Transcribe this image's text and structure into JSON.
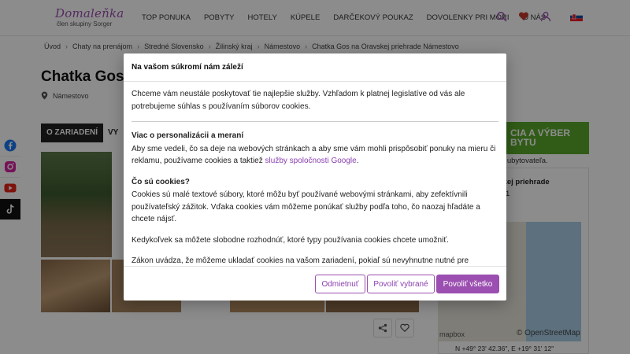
{
  "header": {
    "brand": "Domaleňka",
    "brand_sub": "člen skupiny Sorger",
    "nav": [
      "TOP PONUKA",
      "POBYTY",
      "HOTELY",
      "KÚPELE",
      "DARČEKOVÝ POUKAZ",
      "DOVOLENKY PRI MORI",
      "O NÁS"
    ],
    "icons": [
      "search-icon",
      "heart-icon",
      "user-icon"
    ],
    "flag": "sk-flag"
  },
  "breadcrumb": [
    "Úvod",
    "Chaty na prenájom",
    "Stredné Slovensko",
    "Žilinský kraj",
    "Námestovo",
    "Chatka Gos na Oravskej priehrade Námestovo"
  ],
  "page": {
    "title": "Chatka Gos",
    "location": "Námestovo",
    "tab_active": "O ZARIADENÍ",
    "tab_other": "VY",
    "cta": "CIA A VÝBER BYTU",
    "cta_note": "mo ubytovateľa.",
    "right_heading": "vskej priehrade",
    "right_num": "1"
  },
  "map": {
    "mapbox": "mapbox",
    "attribution": "© OpenStreetMap",
    "coords": "N +49° 23' 42.36\", E +19° 31' 12\""
  },
  "social": [
    "facebook-icon",
    "instagram-icon",
    "youtube-icon",
    "tiktok-icon"
  ],
  "modal": {
    "title": "Na vašom súkromí nám záleží",
    "intro": "Chceme vám neustále poskytovať tie najlepšie služby. Vzhľadom k platnej legislatíve od vás ale potrebujeme súhlas s používaním súborov cookies.",
    "section1_title": "Viac o personalizácii a meraní",
    "section1_text": "Aby sme vedeli, čo sa deje na webových stránkach a aby sme vám mohli prispôsobiť ponuky na mieru či reklamu, používame cookies a taktiež ",
    "section1_link": "služby spoločnosti Google",
    "section1_end": ".",
    "section2_title": "Čo sú cookies?",
    "section2_text": "Cookies sú malé textové súbory, ktoré môžu byť používané webovými stránkami, aby zefektívnili používateľský zážitok. Vďaka cookies vám môžeme ponúkať služby podľa toho, čo naozaj hľadáte a chcete nájsť.",
    "para3": "Kedykoľvek sa môžete slobodne rozhodnúť, ktoré typy používania cookies chcete umožniť.",
    "para4": "Zákon uvádza, že môžeme ukladať cookies na vašom zariadení, pokiaľ sú nevyhnutne nutné pre",
    "btn_reject": "Odmietnuť",
    "btn_selected": "Povoliť vybrané",
    "btn_all": "Povoliť všetko"
  },
  "colors": {
    "brand": "#9b4fb0",
    "cta_green": "#5aa82a"
  }
}
